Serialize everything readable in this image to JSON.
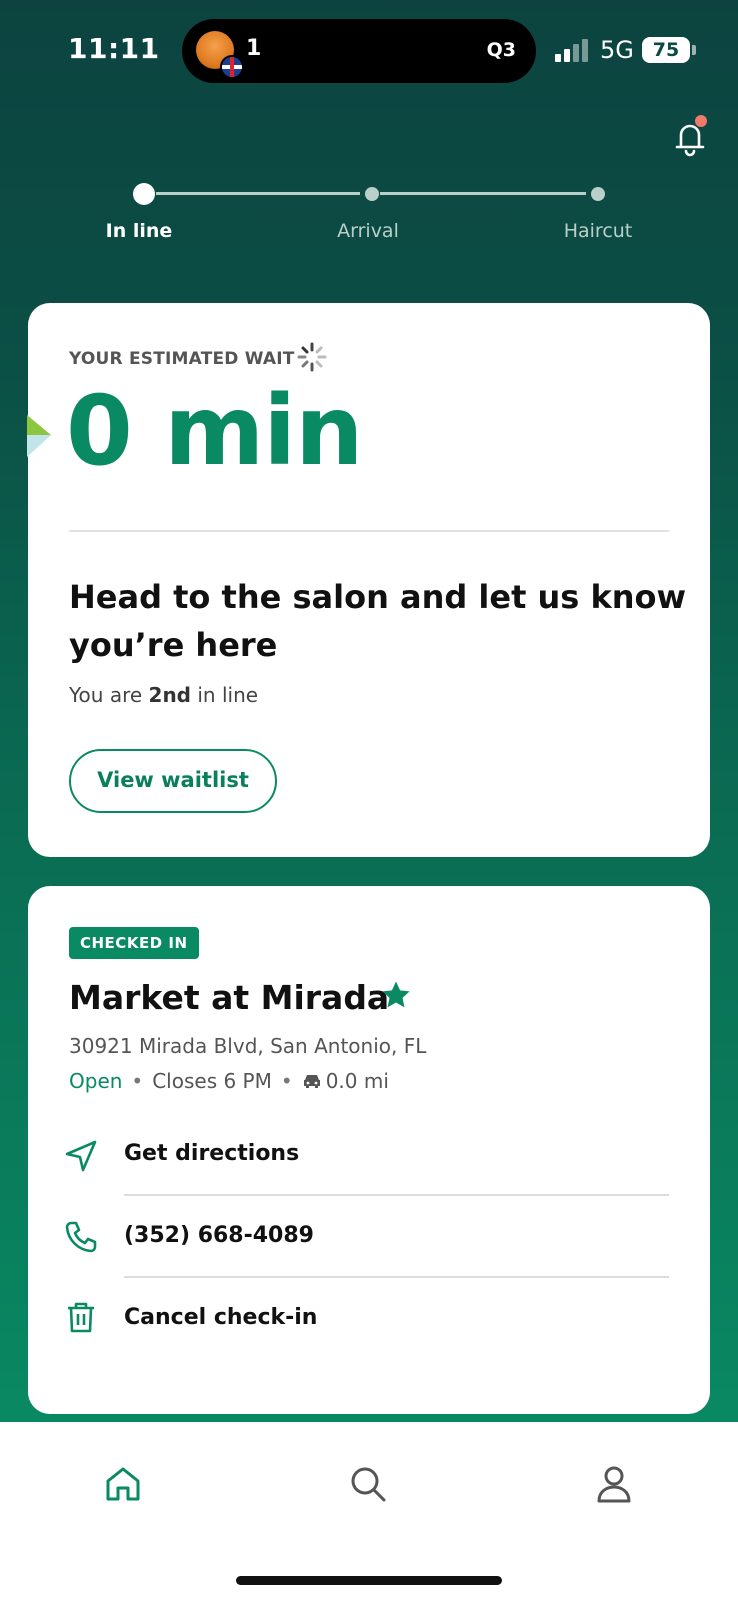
{
  "status_bar": {
    "time": "11:11",
    "island_count": "1",
    "island_score": "Q3",
    "network": "5G",
    "battery": "75"
  },
  "progress": {
    "steps": [
      {
        "label": "In line",
        "active": true
      },
      {
        "label": "Arrival",
        "active": false
      },
      {
        "label": "Haircut",
        "active": false
      }
    ]
  },
  "wait_card": {
    "label": "YOUR ESTIMATED WAIT",
    "value": "0 min",
    "headline": "Head to the salon and let us know you’re here",
    "position_prefix": "You are ",
    "position_rank": "2nd",
    "position_suffix": " in line",
    "waitlist_button": "View waitlist"
  },
  "location_card": {
    "badge": "CHECKED IN",
    "name": "Market at Mirada",
    "address": "30921 Mirada Blvd, San Antonio, FL",
    "status": "Open",
    "closes": "Closes 6 PM",
    "distance": "0.0 mi",
    "actions": [
      {
        "label": "Get directions",
        "icon": "navigation-icon"
      },
      {
        "label": "(352) 668-4089",
        "icon": "phone-icon"
      },
      {
        "label": "Cancel check-in",
        "icon": "trash-icon"
      }
    ]
  },
  "nav": {
    "items": [
      {
        "name": "home",
        "icon": "home-icon",
        "active": true
      },
      {
        "name": "search",
        "icon": "search-icon",
        "active": false
      },
      {
        "name": "profile",
        "icon": "user-icon",
        "active": false
      }
    ]
  },
  "colors": {
    "accent": "#0a8a63",
    "header_top": "#0c4340",
    "header_bottom": "#098962"
  }
}
